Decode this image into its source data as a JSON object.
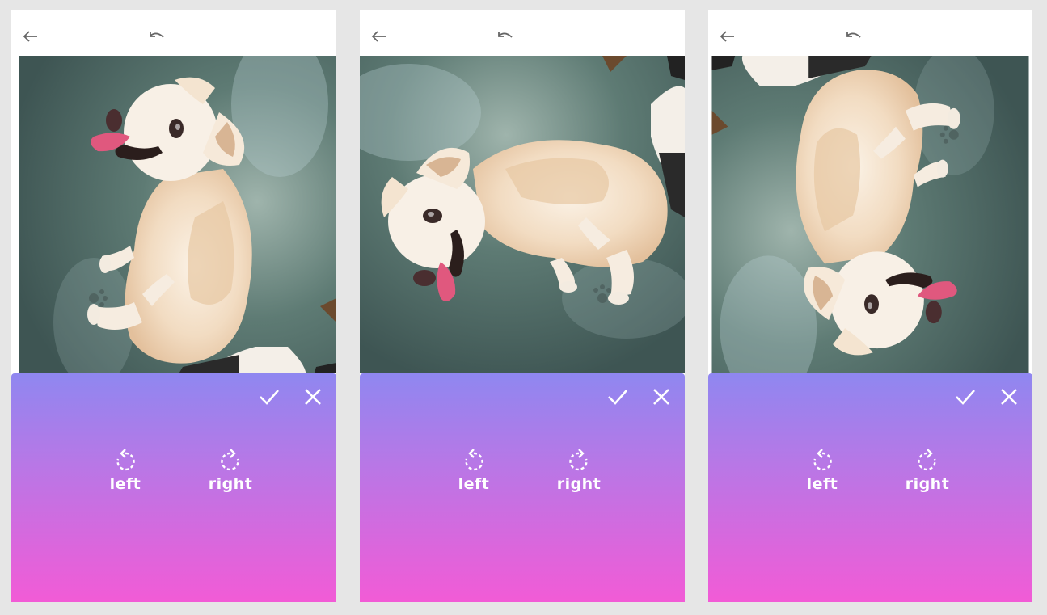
{
  "panels": [
    {
      "id": "panel-1",
      "photo_orientation": "rotated-right",
      "rotate_left_label": "left",
      "rotate_right_label": "right"
    },
    {
      "id": "panel-2",
      "photo_orientation": "original",
      "rotate_left_label": "left",
      "rotate_right_label": "right"
    },
    {
      "id": "panel-3",
      "photo_orientation": "rotated-left",
      "rotate_left_label": "left",
      "rotate_right_label": "right"
    }
  ],
  "icons": {
    "back": "arrow-left-icon",
    "undo": "undo-icon",
    "confirm": "checkmark-icon",
    "cancel": "close-icon",
    "rotate_left": "rotate-left-icon",
    "rotate_right": "rotate-right-icon"
  },
  "colors": {
    "sheet_gradient_top": "#8f87f0",
    "sheet_gradient_bottom": "#f25bd6",
    "floor": "#5f7a73",
    "toolbar_icon": "#666666"
  }
}
